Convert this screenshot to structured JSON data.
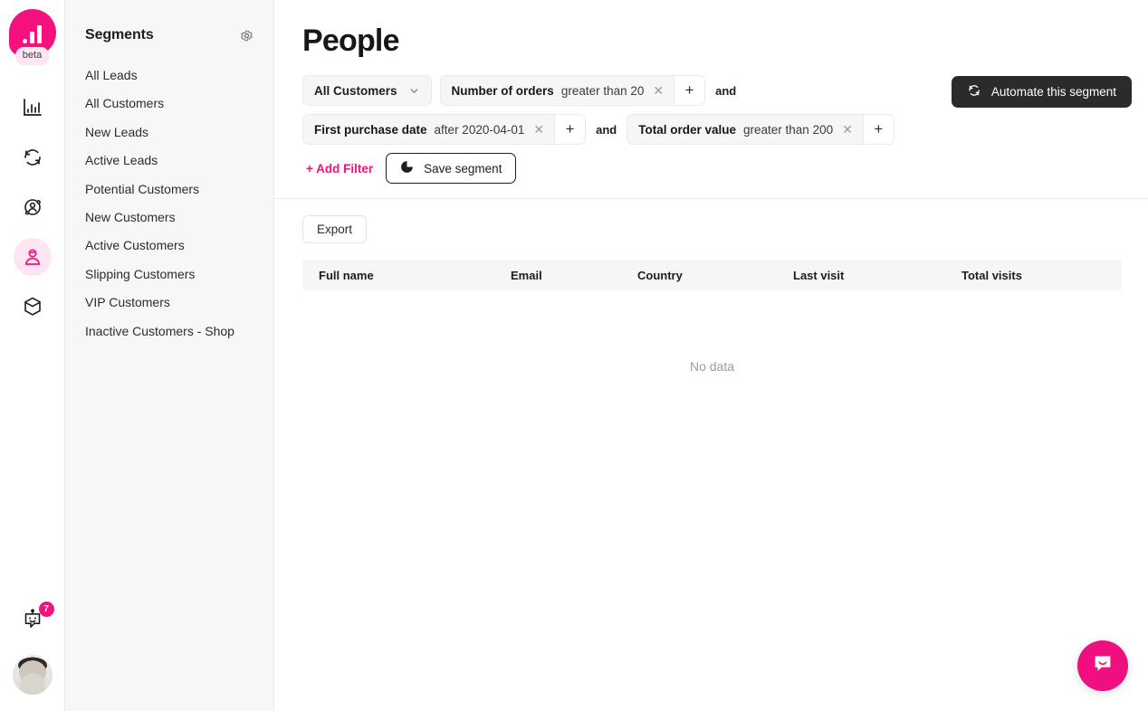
{
  "rail": {
    "logo_name": "logo-chart-bubble",
    "beta_label": "beta",
    "items": [
      {
        "name": "analytics-icon",
        "label": "Analytics"
      },
      {
        "name": "automations-icon",
        "label": "Automations"
      },
      {
        "name": "audience-icon",
        "label": "Audience"
      },
      {
        "name": "people-icon",
        "label": "People"
      },
      {
        "name": "products-icon",
        "label": "Products"
      }
    ],
    "bot_badge_count": "7"
  },
  "sidebar": {
    "title": "Segments",
    "settings_icon": "gear-icon",
    "items": [
      {
        "label": "All Leads"
      },
      {
        "label": "All Customers"
      },
      {
        "label": "New Leads"
      },
      {
        "label": "Active Leads"
      },
      {
        "label": "Potential Customers"
      },
      {
        "label": "New Customers"
      },
      {
        "label": "Active Customers"
      },
      {
        "label": "Slipping Customers"
      },
      {
        "label": "VIP Customers"
      },
      {
        "label": "Inactive Customers - Shop"
      }
    ]
  },
  "main": {
    "page_title": "People",
    "audience_select": {
      "value": "All Customers",
      "icon": "chevron-down-icon"
    },
    "conditions": [
      {
        "field": "Number of orders",
        "operator_value": "greater than 20",
        "remove_icon": "close-icon",
        "add_icon": "plus-icon"
      },
      {
        "field": "First purchase date",
        "operator_value": "after 2020-04-01",
        "remove_icon": "close-icon",
        "add_icon": "plus-icon"
      },
      {
        "field": "Total order value",
        "operator_value": "greater than 200",
        "remove_icon": "close-icon",
        "add_icon": "plus-icon"
      }
    ],
    "conjunction": "and",
    "add_filter_label": "+ Add Filter",
    "save_segment_label": "Save segment",
    "save_segment_icon": "pie-chart-icon",
    "automate_label": "Automate this segment",
    "automate_icon": "refresh-icon",
    "export_label": "Export",
    "table": {
      "columns": [
        "Full name",
        "Email",
        "Country",
        "Last visit",
        "Total visits"
      ],
      "rows": [],
      "empty_text": "No data"
    }
  },
  "support": {
    "launcher_icon": "chat-bubble-icon"
  },
  "colors": {
    "accent": "#f5127e",
    "accent_soft": "#fde6f1",
    "dark_button": "#2b2b2d",
    "panel_bg": "#f7f7f8",
    "chip_bg": "#f6f6f7",
    "border": "#e8e8ea",
    "muted_text": "#9b9ba2"
  }
}
